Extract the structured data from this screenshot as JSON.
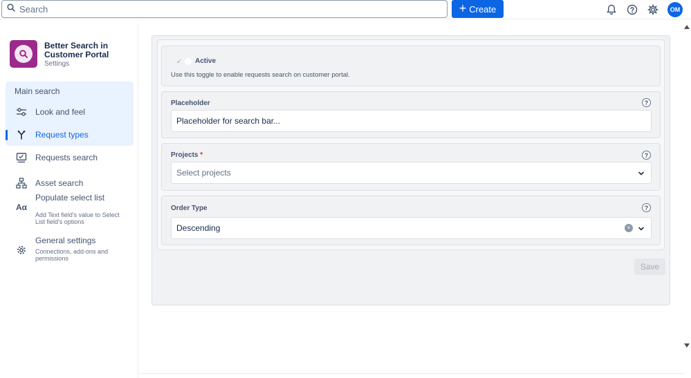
{
  "topbar": {
    "search_label": "Search",
    "create_label": "Create",
    "avatar_initials": "OM"
  },
  "app": {
    "name": "Better Search in Customer Portal",
    "subtitle": "Settings",
    "logo_color": "#9c2a8c"
  },
  "sidebar": {
    "group_label": "Main search",
    "items": [
      {
        "label": "Look and feel",
        "icon": "sliders-icon"
      },
      {
        "label": "Request types",
        "icon": "fork-icon",
        "active": true
      },
      {
        "label": "Requests search",
        "icon": "monitor-icon"
      },
      {
        "label": "Asset search",
        "icon": "hierarchy-icon"
      },
      {
        "label": "Populate select list",
        "icon": "text-aa-icon",
        "description": "Add Text field's value to Select List field's options"
      },
      {
        "label": "General settings",
        "icon": "gear-icon",
        "description": "Connections, add-ons and permissions"
      }
    ]
  },
  "form": {
    "active": {
      "label": "Active",
      "help_text": "Use this toggle to enable requests search on customer portal."
    },
    "placeholder": {
      "label": "Placeholder",
      "value": "Placeholder for search bar..."
    },
    "projects": {
      "label": "Projects",
      "required_mark": "*",
      "placeholder": "Select projects"
    },
    "order_type": {
      "label": "Order Type",
      "value": "Descending"
    },
    "help_glyph": "?",
    "save_label": "Save"
  },
  "colors": {
    "accent": "#0c66e4",
    "required": "#c9372c"
  }
}
